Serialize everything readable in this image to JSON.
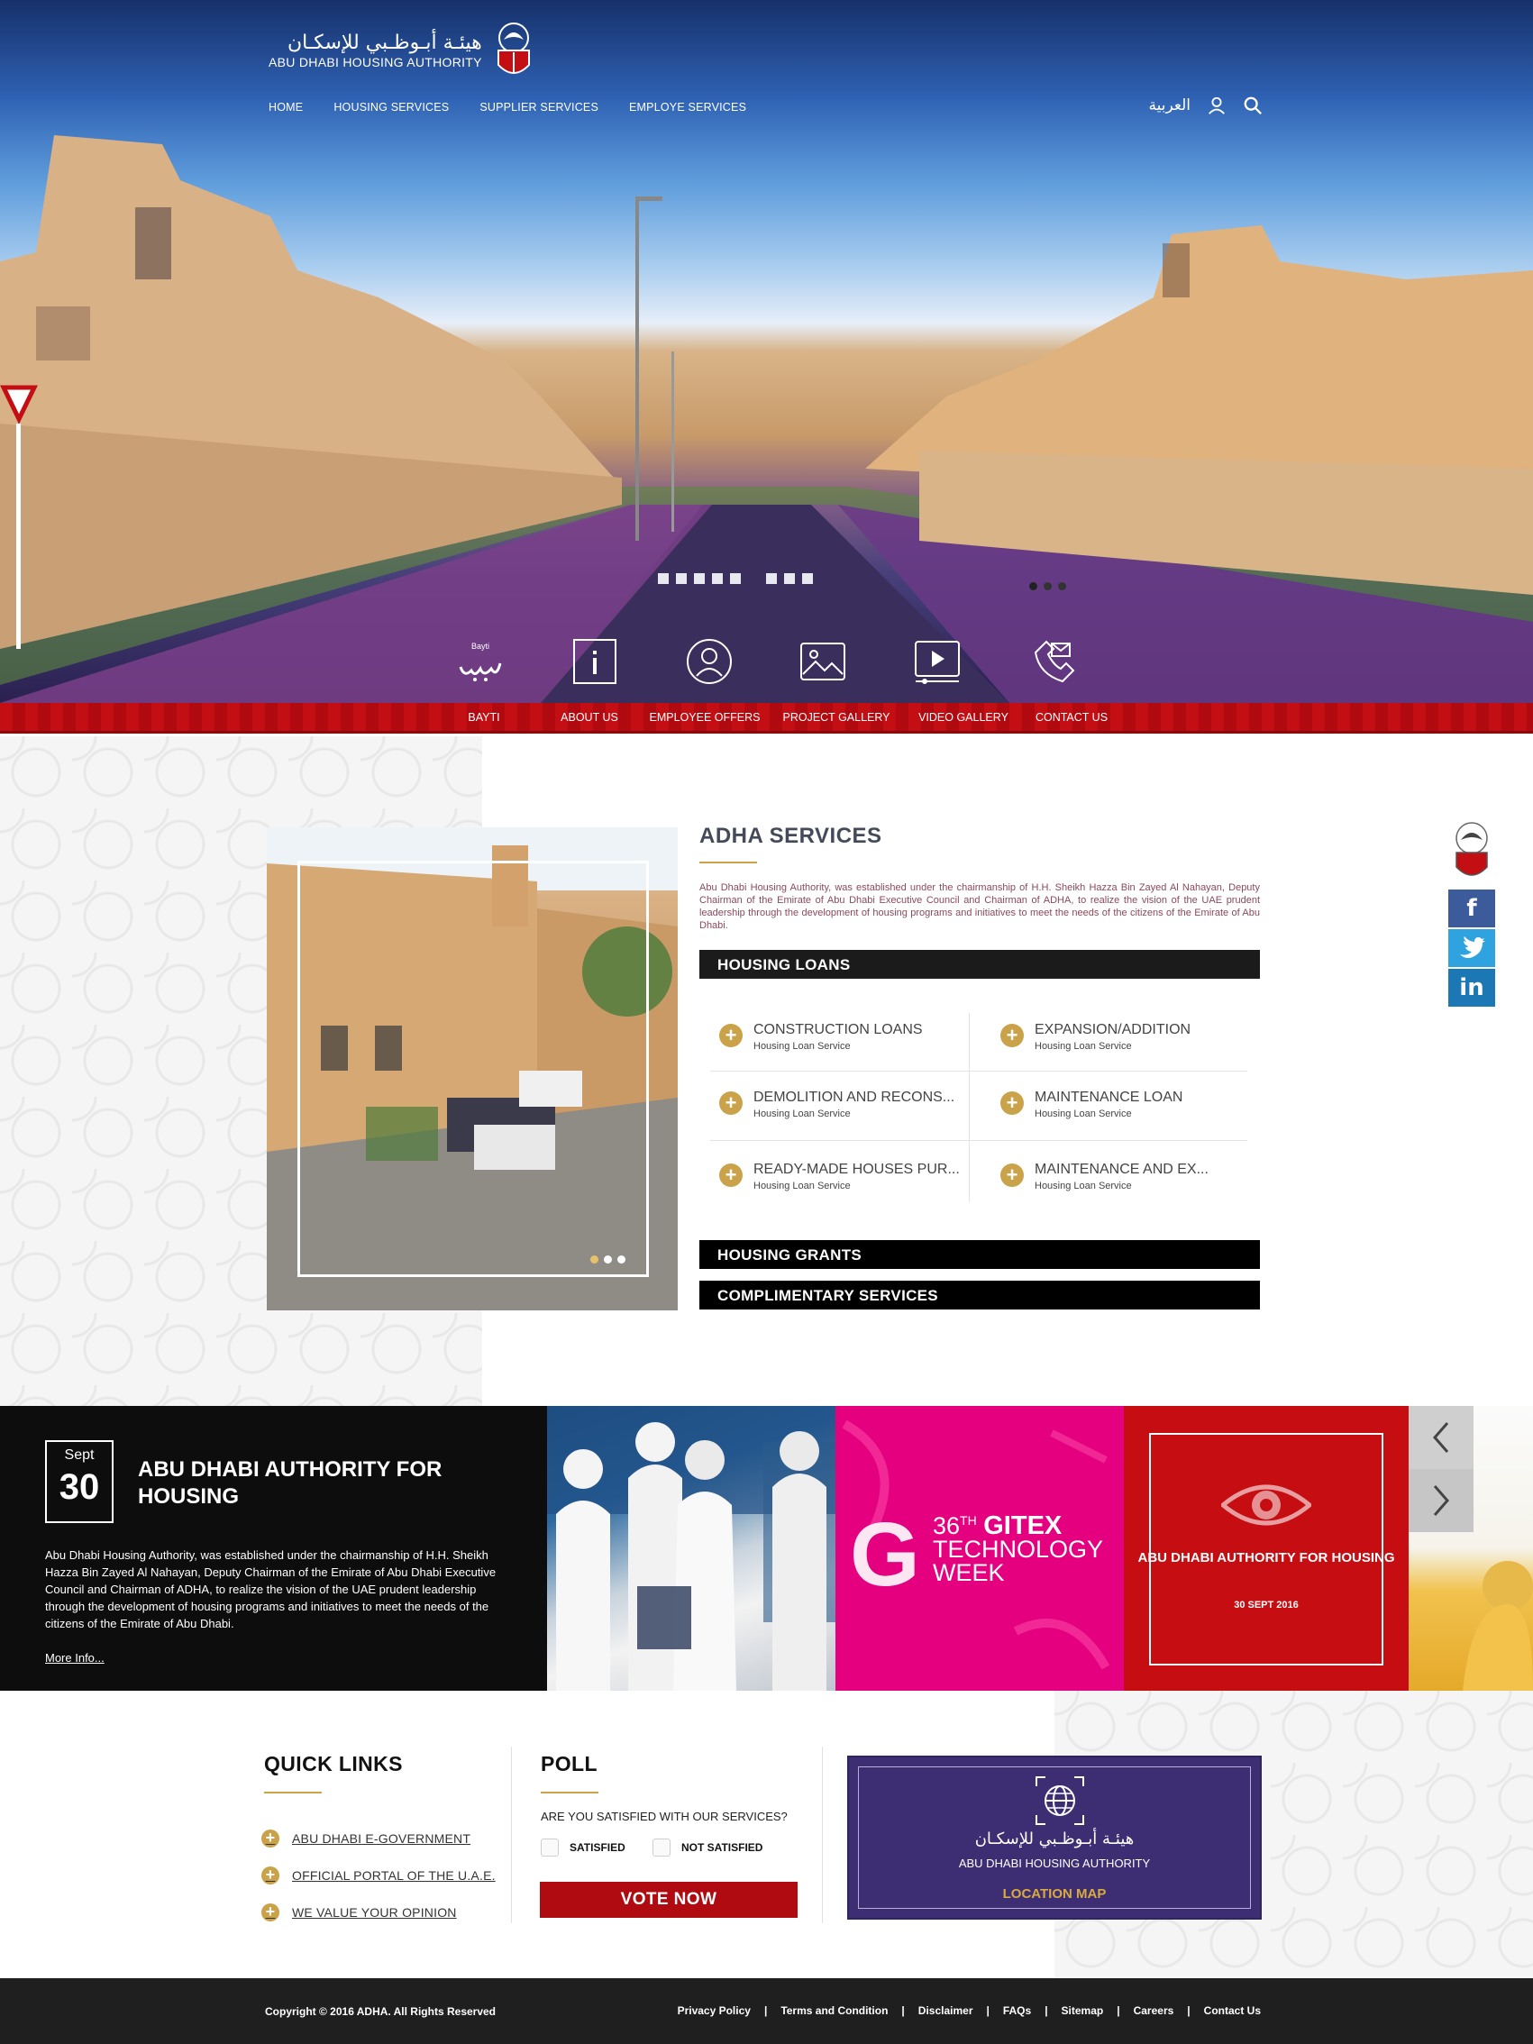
{
  "header": {
    "logo_ar": "هيئـة أبـوظـبي للإسكـان",
    "logo_en": "ABU DHABI HOUSING AUTHORITY",
    "nav": [
      "HOME",
      "HOUSING SERVICES",
      "SUPPLIER SERVICES",
      "EMPLOYE SERVICES"
    ],
    "language_label": "العربية",
    "user_icon": "user-icon",
    "search_icon": "search-icon"
  },
  "hero": {
    "slides_total": 3,
    "active_slide": 1,
    "quick_icons": [
      "bayti-logo-icon",
      "info-icon",
      "employee-icon",
      "gallery-icon",
      "video-icon",
      "contact-icon"
    ],
    "bayti_small": "Bayti"
  },
  "quicknav": [
    "BAYTI",
    "ABOUT US",
    "EMPLOYEE OFFERS",
    "PROJECT GALLERY",
    "VIDEO GALLERY",
    "CONTACT US"
  ],
  "services": {
    "title": "ADHA SERVICES",
    "description": "Abu Dhabi Housing Authority, was established under the chairmanship of H.H. Sheikh Hazza Bin Zayed Al Nahayan, Deputy Chairman of the Emirate of Abu Dhabi Executive Council and Chairman of ADHA, to realize the vision of the UAE prudent leadership through the development of housing programs and initiatives to meet the needs of the citizens of the Emirate of Abu Dhabi.",
    "categories": [
      "HOUSING LOANS",
      "HOUSING GRANTS",
      "COMPLIMENTARY SERVICES"
    ],
    "loans": [
      {
        "name": "CONSTRUCTION LOANS",
        "sub": "Housing Loan Service"
      },
      {
        "name": "EXPANSION/ADDITION",
        "sub": "Housing Loan Service"
      },
      {
        "name": "DEMOLITION AND RECONS...",
        "sub": "Housing Loan Service"
      },
      {
        "name": "MAINTENANCE LOAN",
        "sub": "Housing Loan Service"
      },
      {
        "name": "READY-MADE HOUSES PUR...",
        "sub": "Housing Loan Service"
      },
      {
        "name": "MAINTENANCE AND EX...",
        "sub": "Housing Loan Service"
      }
    ],
    "photo_slides_total": 3,
    "photo_active_slide": 1
  },
  "social": {
    "facebook": "f",
    "twitter": "twitter-bird-icon",
    "linkedin": "in"
  },
  "news": {
    "month": "Sept",
    "day": "30",
    "title": "ABU DHABI AUTHORITY FOR HOUSING",
    "text": "Abu Dhabi Housing Authority, was established under the chairmanship of H.H. Sheikh Hazza Bin Zayed Al Nahayan, Deputy Chairman of the Emirate of Abu Dhabi Executive Council and Chairman of ADHA, to realize the vision of the UAE prudent leadership through the development of housing programs and initiatives to meet the needs of the citizens of the Emirate of Abu Dhabi.",
    "more": "More Info...",
    "gitex_number": "36",
    "gitex_sup": "TH",
    "gitex_word": "GITEX",
    "gitex_line2": "TECHNOLOGY",
    "gitex_line3": "WEEK",
    "gitex_g": "G",
    "red_tile_title": "ABU DHABI AUTHORITY FOR HOUSING",
    "red_tile_date": "30 SEPT 2016"
  },
  "quick_links": {
    "title": "QUICK LINKS",
    "items": [
      "ABU DHABI E-GOVERNMENT",
      "OFFICIAL PORTAL OF THE U.A.E.",
      "WE VALUE YOUR OPINION"
    ]
  },
  "poll": {
    "title": "POLL",
    "question": "ARE YOU SATISFIED WITH OUR SERVICES?",
    "options": [
      "SATISFIED",
      "NOT SATISFIED"
    ],
    "button": "VOTE NOW"
  },
  "map": {
    "ar": "هيئـة أبـوظـبي للإسكـان",
    "en": "ABU DHABI HOUSING AUTHORITY",
    "link": "LOCATION MAP"
  },
  "footer": {
    "copyright": "Copyright © 2016 ADHA. All Rights Reserved",
    "links": [
      "Privacy Policy",
      "Terms and Condition",
      "Disclaimer",
      "FAQs",
      "Sitemap",
      "Careers",
      "Contact Us"
    ],
    "separator": "|"
  },
  "colors": {
    "brand_red": "#c30f13",
    "gold": "#c9a24a",
    "gitex_pink": "#e4007e",
    "map_purple": "#3d2e73"
  }
}
